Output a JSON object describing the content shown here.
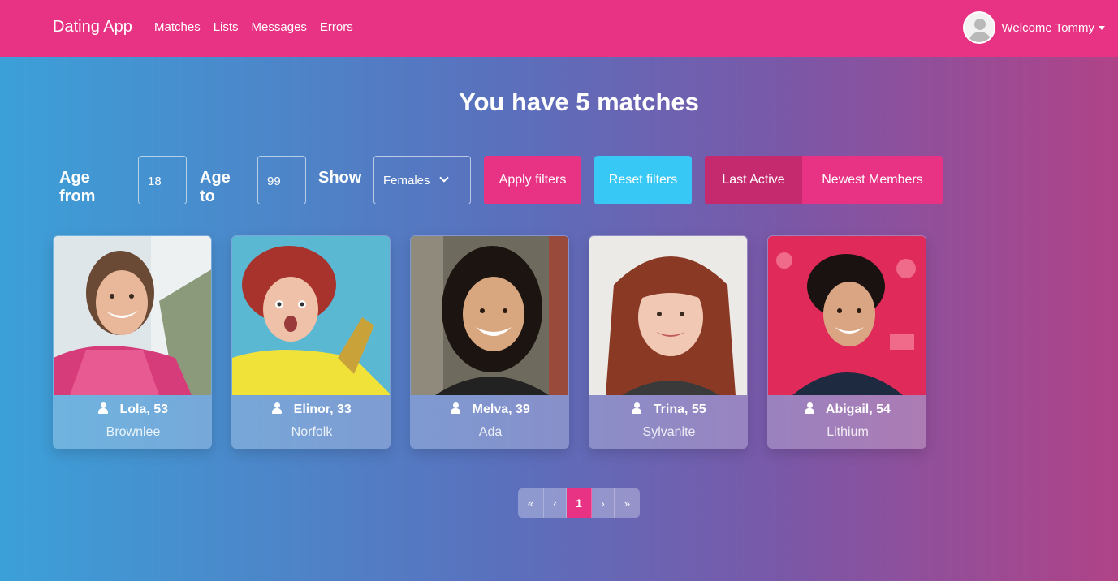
{
  "navbar": {
    "brand": "Dating App",
    "links": [
      "Matches",
      "Lists",
      "Messages",
      "Errors"
    ],
    "welcome": "Welcome Tommy",
    "accent": "#e83283"
  },
  "page": {
    "title": "You have 5 matches"
  },
  "filters": {
    "age_from_label": "Age from",
    "age_from_value": "18",
    "age_to_label": "Age to",
    "age_to_value": "99",
    "show_label": "Show",
    "show_value": "Females",
    "apply_label": "Apply filters",
    "reset_label": "Reset filters",
    "sort_last_active": "Last Active",
    "sort_newest": "Newest Members"
  },
  "members": [
    {
      "name": "Lola, 53",
      "city": "Brownlee"
    },
    {
      "name": "Elinor, 33",
      "city": "Norfolk"
    },
    {
      "name": "Melva, 39",
      "city": "Ada"
    },
    {
      "name": "Trina, 55",
      "city": "Sylvanite"
    },
    {
      "name": "Abigail, 54",
      "city": "Lithium"
    }
  ],
  "pagination": {
    "first": "«",
    "prev": "‹",
    "current": "1",
    "next": "›",
    "last": "»"
  }
}
